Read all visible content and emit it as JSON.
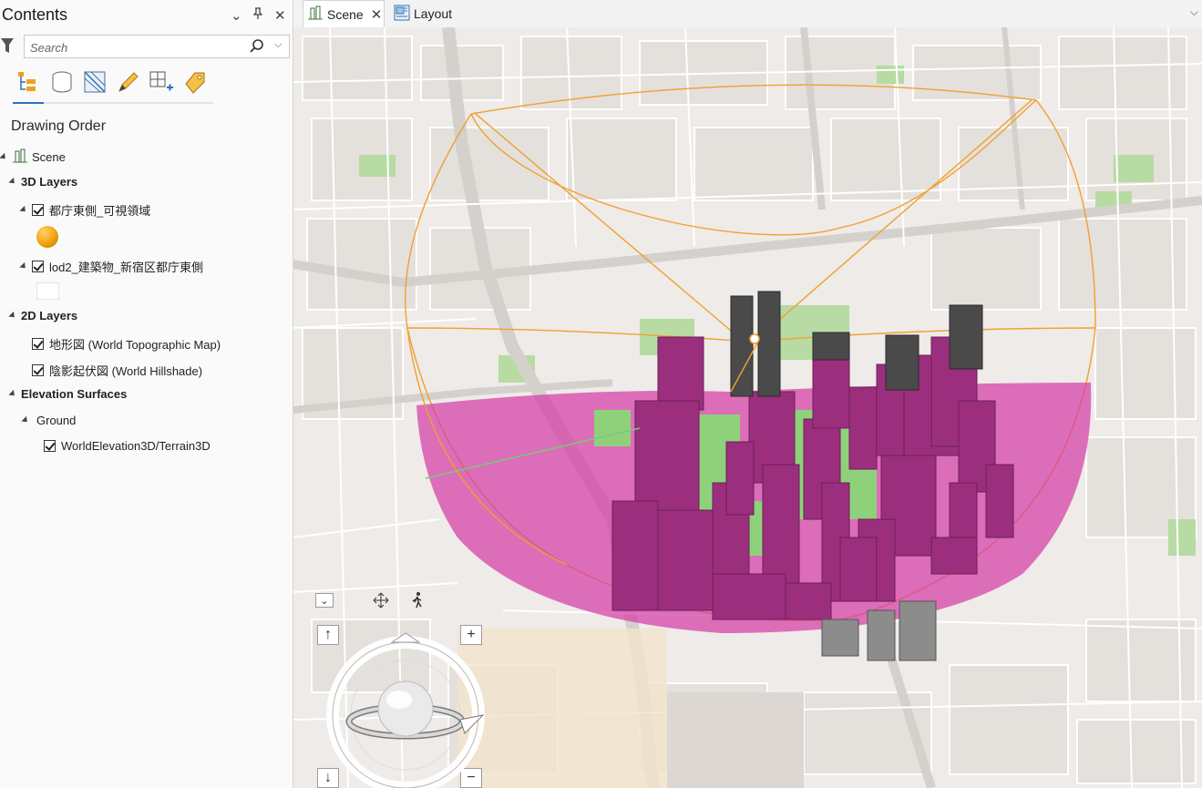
{
  "contents_pane": {
    "title": "Contents",
    "search": {
      "placeholder": "Search",
      "value": ""
    },
    "section_title": "Drawing Order",
    "tree": {
      "root": "Scene",
      "layers_3d": {
        "label": "3D Layers",
        "items": [
          {
            "label": "都庁東側_可視領域",
            "checked": true,
            "symbol": "orange-sphere"
          },
          {
            "label": "lod2_建築物_新宿区都庁東側",
            "checked": true,
            "symbol": "white-fill"
          }
        ]
      },
      "layers_2d": {
        "label": "2D Layers",
        "items": [
          {
            "label": "地形図 (World Topographic Map)",
            "checked": true
          },
          {
            "label": "陰影起伏図 (World Hillshade)",
            "checked": true
          }
        ]
      },
      "elevation": {
        "label": "Elevation Surfaces",
        "ground": {
          "label": "Ground",
          "items": [
            {
              "label": "WorldElevation3D/Terrain3D",
              "checked": true
            }
          ]
        }
      }
    }
  },
  "tabs": [
    {
      "label": "Scene",
      "active": true,
      "icon": "scene-icon"
    },
    {
      "label": "Layout",
      "active": false,
      "icon": "layout-icon"
    }
  ],
  "colors": {
    "viewshed_fill": "#d63ca6",
    "buildings": "#9b2f7e",
    "viewshed_outline": "#f0a030",
    "park_green": "#8fd17a",
    "map_background": "#efecea"
  }
}
